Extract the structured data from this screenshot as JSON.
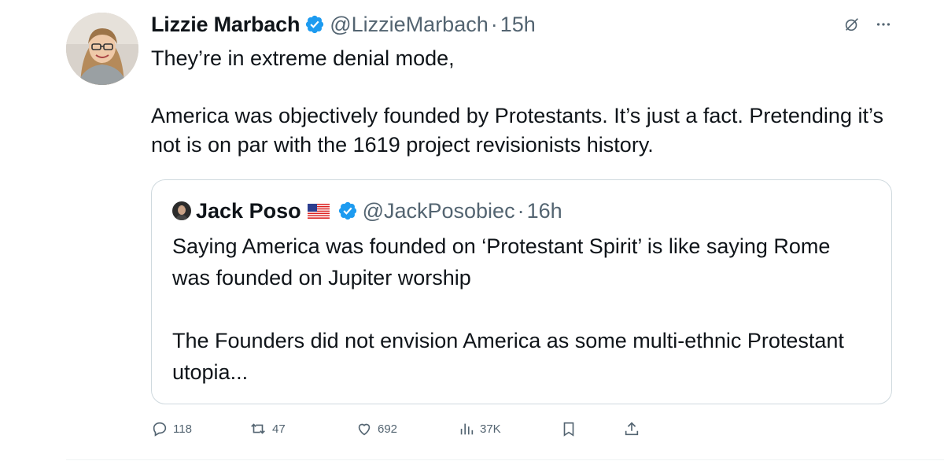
{
  "tweet": {
    "author_name": "Lizzie Marbach",
    "handle": "@LizzieMarbach",
    "separator": "·",
    "time": "15h",
    "text_line1": "They’re in extreme denial mode,",
    "text_line2": "America was objectively founded by Protestants. It’s just a fact. Pretending it’s not is on par with the 1619 project revisionists history."
  },
  "quoted_tweet": {
    "author_name": "Jack Poso",
    "flag_emoji": "🇺🇸",
    "handle": "@JackPosobiec",
    "separator": "·",
    "time": "16h",
    "text_line1": "Saying America was founded on ‘Protestant Spirit’ is like saying Rome was founded on Jupiter worship",
    "text_line2": "The Founders did not envision America as some multi-ethnic Protestant utopia..."
  },
  "actions": {
    "replies": "118",
    "reposts": "47",
    "likes": "692",
    "views": "37K"
  },
  "colors": {
    "verified_blue": "#1d9bf0",
    "muted_gray": "#536471",
    "border": "#cfd9de"
  },
  "icons": {
    "verified": "verified-badge-icon",
    "grok": "grok-icon",
    "more": "more-options-icon",
    "reply": "reply-icon",
    "repost": "repost-icon",
    "like": "heart-icon",
    "views": "views-chart-icon",
    "bookmark": "bookmark-icon",
    "share": "share-icon"
  }
}
